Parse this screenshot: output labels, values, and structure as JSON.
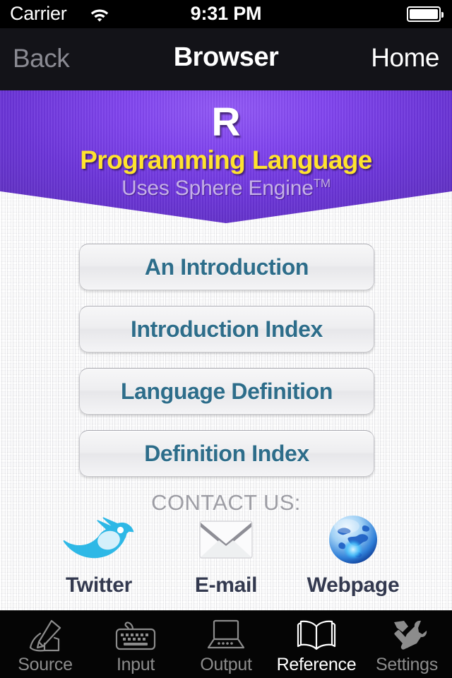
{
  "status_bar": {
    "carrier": "Carrier",
    "wifi_icon": "wifi-icon",
    "time": "9:31 PM",
    "battery_icon": "battery-icon"
  },
  "nav_bar": {
    "back_label": "Back",
    "title": "Browser",
    "home_label": "Home"
  },
  "banner": {
    "logo": "R",
    "subtitle": "Programming Language",
    "engine_line": "Uses Sphere Engine",
    "engine_mark": "TM",
    "colors": {
      "purple_light": "#9158f5",
      "purple_dark": "#5a2fb8",
      "yellow": "#ffe32e",
      "lavender": "#c5b0e8"
    }
  },
  "menu": {
    "items": [
      {
        "label": "An Introduction",
        "name": "menu-an-introduction"
      },
      {
        "label": "Introduction Index",
        "name": "menu-introduction-index"
      },
      {
        "label": "Language Definition",
        "name": "menu-language-definition"
      },
      {
        "label": "Definition Index",
        "name": "menu-definition-index"
      }
    ],
    "text_color": "#2d6d8a"
  },
  "contact": {
    "title": "CONTACT US:",
    "items": [
      {
        "label": "Twitter",
        "icon": "twitter-bird-icon"
      },
      {
        "label": "E-mail",
        "icon": "envelope-icon"
      },
      {
        "label": "Webpage",
        "icon": "globe-icon"
      }
    ]
  },
  "tab_bar": {
    "active_index": 3,
    "items": [
      {
        "label": "Source",
        "icon": "hand-writing-pen-icon"
      },
      {
        "label": "Input",
        "icon": "keyboard-icon"
      },
      {
        "label": "Output",
        "icon": "laptop-icon"
      },
      {
        "label": "Reference",
        "icon": "open-book-icon"
      },
      {
        "label": "Settings",
        "icon": "hammer-wrench-icon"
      }
    ]
  }
}
